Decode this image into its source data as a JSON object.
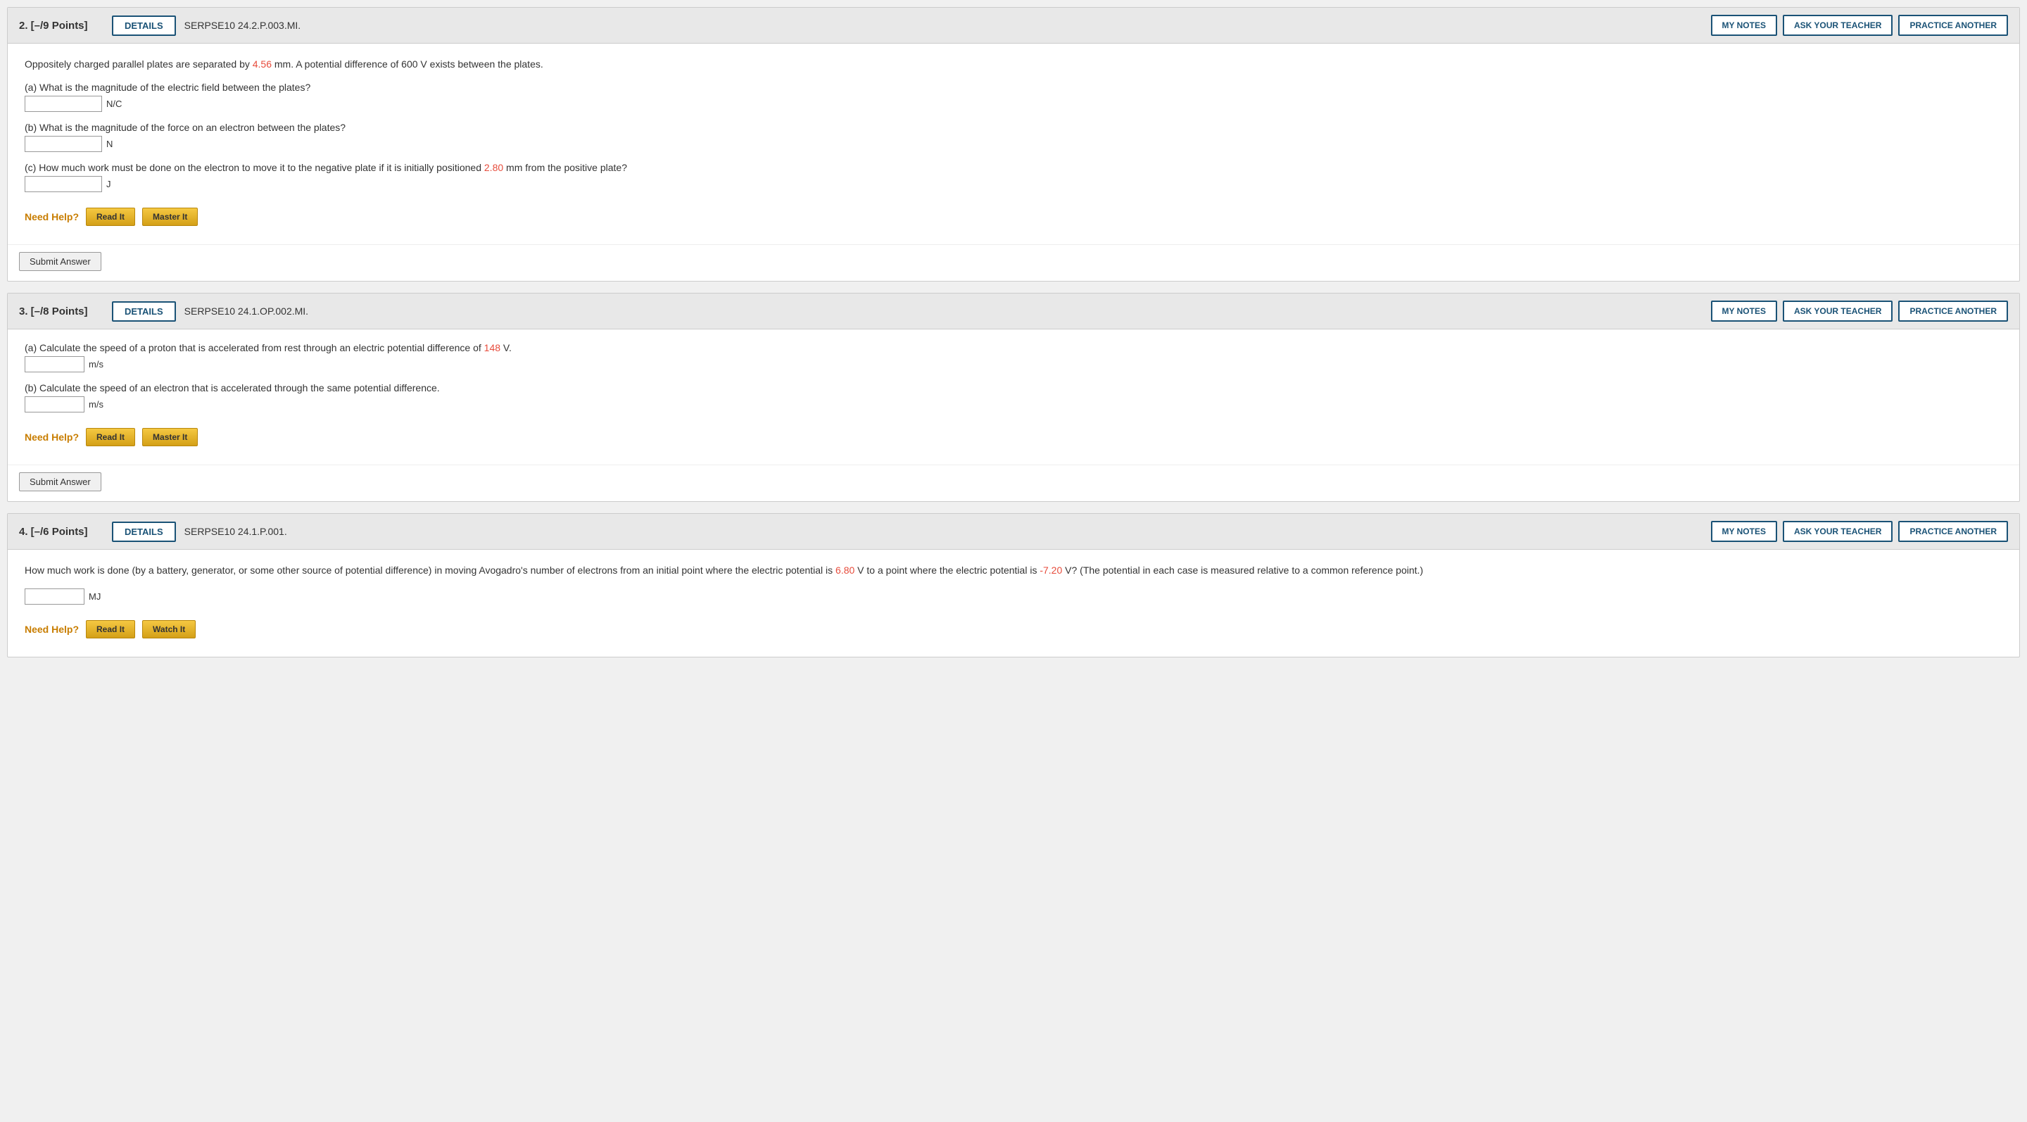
{
  "problem2": {
    "header": {
      "number": "2.  [–/9 Points]",
      "details_label": "DETAILS",
      "code": "SERPSE10 24.2.P.003.MI.",
      "my_notes_label": "MY NOTES",
      "ask_teacher_label": "ASK YOUR TEACHER",
      "practice_another_label": "PRACTICE ANOTHER"
    },
    "body": {
      "intro": "Oppositely charged parallel plates are separated by ",
      "highlight1": "4.56",
      "intro2": " mm. A potential difference of 600 V exists between the plates.",
      "part_a": {
        "label": "(a) What is the magnitude of the electric field between the plates?",
        "unit": "N/C"
      },
      "part_b": {
        "label": "(b) What is the magnitude of the force on an electron between the plates?",
        "unit": "N"
      },
      "part_c": {
        "label_pre": "(c) How much work must be done on the electron to move it to the negative plate if it is initially positioned ",
        "highlight": "2.80",
        "label_post": " mm from the positive plate?",
        "unit": "J"
      },
      "need_help_label": "Need Help?",
      "read_it_label": "Read It",
      "master_it_label": "Master It",
      "submit_label": "Submit Answer"
    }
  },
  "problem3": {
    "header": {
      "number": "3.  [–/8 Points]",
      "details_label": "DETAILS",
      "code": "SERPSE10 24.1.OP.002.MI.",
      "my_notes_label": "MY NOTES",
      "ask_teacher_label": "ASK YOUR TEACHER",
      "practice_another_label": "PRACTICE ANOTHER"
    },
    "body": {
      "part_a": {
        "label_pre": "(a) Calculate the speed of a proton that is accelerated from rest through an electric potential difference of ",
        "highlight": "148",
        "label_post": " V.",
        "unit": "m/s"
      },
      "part_b": {
        "label": "(b) Calculate the speed of an electron that is accelerated through the same potential difference.",
        "unit": "m/s"
      },
      "need_help_label": "Need Help?",
      "read_it_label": "Read It",
      "master_it_label": "Master It",
      "submit_label": "Submit Answer"
    }
  },
  "problem4": {
    "header": {
      "number": "4.  [–/6 Points]",
      "details_label": "DETAILS",
      "code": "SERPSE10 24.1.P.001.",
      "my_notes_label": "MY NOTES",
      "ask_teacher_label": "ASK YOUR TEACHER",
      "practice_another_label": "PRACTICE ANOTHER"
    },
    "body": {
      "intro": "How much work is done (by a battery, generator, or some other source of potential difference) in moving Avogadro's number of electrons from an initial point where the electric potential is ",
      "highlight1": "6.80",
      "mid": " V to a point where the electric potential is ",
      "highlight2": "-7.20",
      "end": " V? (The potential in each case is measured relative to a common reference point.)",
      "unit": "MJ",
      "need_help_label": "Need Help?",
      "read_it_label": "Read It",
      "watch_it_label": "Watch It"
    }
  }
}
